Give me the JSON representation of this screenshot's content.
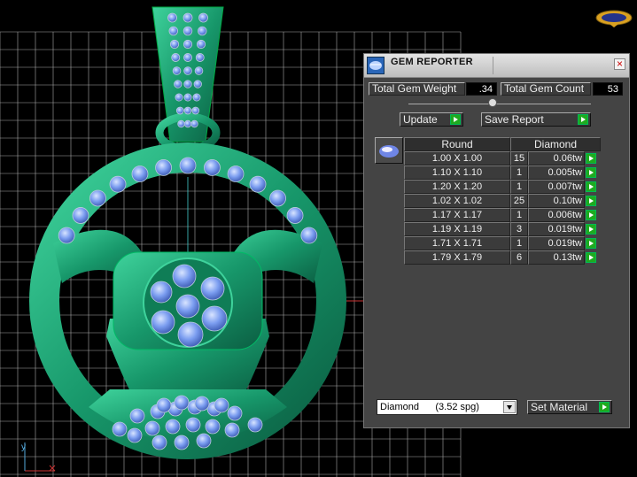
{
  "title": "GEM REPORTER",
  "close_glyph": "×",
  "totals": {
    "weight_label": "Total Gem Weight",
    "weight_value": ".34",
    "count_label": "Total Gem Count",
    "count_value": "53"
  },
  "buttons": {
    "update": "Update",
    "save_report": "Save Report",
    "set_material": "Set Material"
  },
  "table": {
    "headers": [
      "Round",
      "Diamond"
    ],
    "rows": [
      {
        "size": "1.00 X 1.00",
        "count": "15",
        "weight": "0.06tw"
      },
      {
        "size": "1.10 X 1.10",
        "count": "1",
        "weight": "0.005tw"
      },
      {
        "size": "1.20 X 1.20",
        "count": "1",
        "weight": "0.007tw"
      },
      {
        "size": "1.02 X 1.02",
        "count": "25",
        "weight": "0.10tw"
      },
      {
        "size": "1.17 X 1.17",
        "count": "1",
        "weight": "0.006tw"
      },
      {
        "size": "1.19 X 1.19",
        "count": "3",
        "weight": "0.019tw"
      },
      {
        "size": "1.71 X 1.71",
        "count": "1",
        "weight": "0.019tw"
      },
      {
        "size": "1.79 X 1.79",
        "count": "6",
        "weight": "0.13tw"
      }
    ]
  },
  "material": {
    "selected": "Diamond      (3.52 spg)"
  },
  "axes": {
    "y": "y"
  },
  "colors": {
    "metal": "#1a9a6c",
    "gem": "#7b9df0",
    "grid": "#c8c8c8",
    "accent_green": "#1faa1f",
    "panel": "#444444"
  },
  "icons": [
    "gem-reporter-icon",
    "close-icon",
    "play-arrow-icon",
    "gem-shape-icon",
    "dropdown-arrow-icon",
    "logo-icon"
  ]
}
